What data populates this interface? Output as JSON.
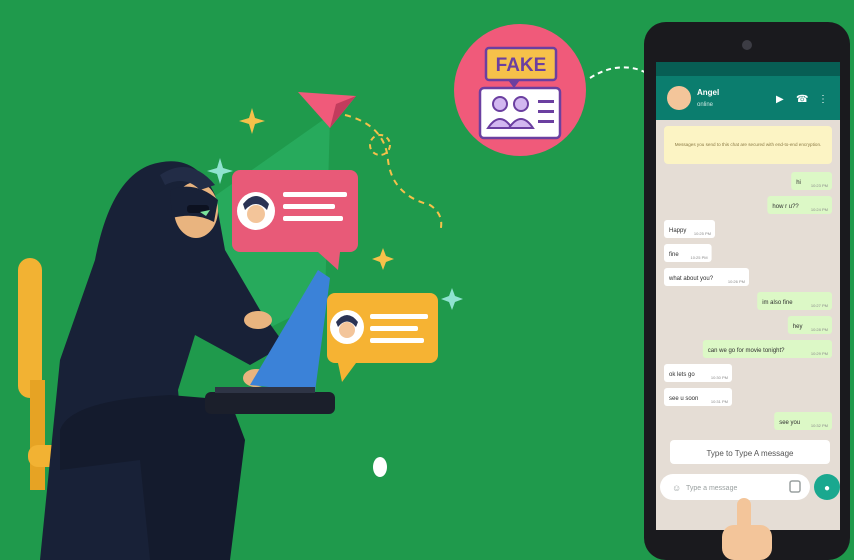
{
  "badge": {
    "label": "FAKE"
  },
  "chat": {
    "contact_name": "Angel",
    "contact_status": "online",
    "notice": "Messages you send to this chat are secured with end-to-end encryption.",
    "messages": [
      {
        "side": "out",
        "text": "hi",
        "time": "10:23 PM"
      },
      {
        "side": "out",
        "text": "how r u??",
        "time": "10:24 PM"
      },
      {
        "side": "in",
        "text": "Happy",
        "time": "10:25 PM"
      },
      {
        "side": "in",
        "text": "fine",
        "time": "10:25 PM"
      },
      {
        "side": "in",
        "text": "what about you?",
        "time": "10:26 PM"
      },
      {
        "side": "out",
        "text": "im also fine",
        "time": "10:27 PM"
      },
      {
        "side": "out",
        "text": "hey",
        "time": "10:28 PM"
      },
      {
        "side": "out",
        "text": "can we go for movie tonight?",
        "time": "10:29 PM"
      },
      {
        "side": "in",
        "text": "ok lets go",
        "time": "10:30 PM"
      },
      {
        "side": "in",
        "text": "see u soon",
        "time": "10:31 PM"
      },
      {
        "side": "out",
        "text": "see you",
        "time": "10:32 PM"
      }
    ],
    "banner": "Type to Type A message",
    "input_placeholder": "Type a message"
  },
  "colors": {
    "background": "#1f9a4c",
    "hacker": "#182137",
    "pink_bubble": "#e85a78",
    "yellow_bubble": "#f6b333",
    "badge_circle": "#f05a7a",
    "chair": "#f2b233"
  }
}
